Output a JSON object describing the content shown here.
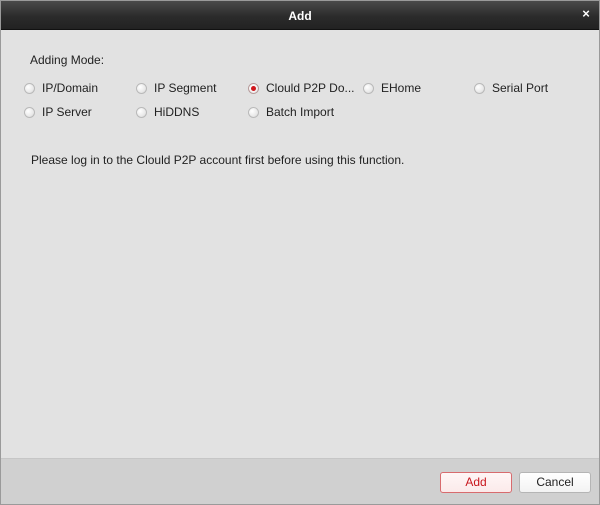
{
  "dialog": {
    "title": "Add",
    "close_glyph": "×"
  },
  "adding_mode": {
    "label": "Adding Mode:",
    "options": [
      {
        "label": "IP/Domain",
        "checked": false
      },
      {
        "label": "IP Segment",
        "checked": false
      },
      {
        "label": "Clould P2P Do...",
        "checked": true
      },
      {
        "label": "EHome",
        "checked": false
      },
      {
        "label": "Serial Port",
        "checked": false
      },
      {
        "label": "IP Server",
        "checked": false
      },
      {
        "label": "HiDDNS",
        "checked": false
      },
      {
        "label": "Batch Import",
        "checked": false
      }
    ]
  },
  "notice": "Please log in to the Clould P2P account first before using this function.",
  "footer": {
    "add_label": "Add",
    "cancel_label": "Cancel"
  },
  "colors": {
    "accent_red": "#c8161d",
    "titlebar": "#2b2b2b",
    "body_bg": "#e2e2e2"
  }
}
